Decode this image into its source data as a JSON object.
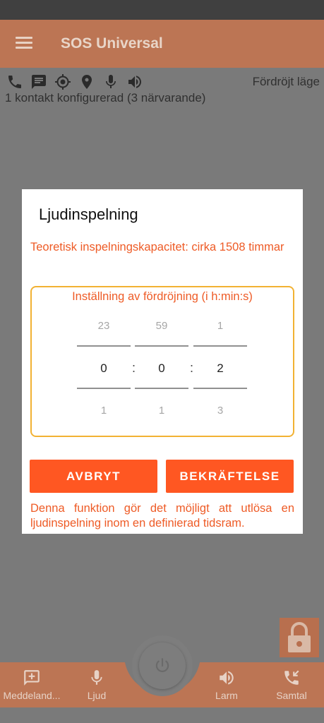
{
  "app": {
    "title": "SOS Universal"
  },
  "status": {
    "mode_label": "Fördröjt läge",
    "contacts_text": "1 kontakt konfigurerad (3 närvarande)",
    "icons": [
      "phone-icon",
      "message-icon",
      "gps-icon",
      "location-pin-icon",
      "microphone-icon",
      "speaker-icon"
    ]
  },
  "dialog": {
    "title": "Ljudinspelning",
    "capacity_text": "Teoretisk inspelningskapacitet: cirka 1508 timmar",
    "delay_label": "Inställning av fördröjning (i h:min:s)",
    "pickers": {
      "hours": {
        "prev": "23",
        "current": "0",
        "next": "1"
      },
      "minutes": {
        "prev": "59",
        "current": "0",
        "next": "1"
      },
      "seconds": {
        "prev": "1",
        "current": "2",
        "next": "3"
      }
    },
    "separator": ":",
    "cancel_label": "AVBRYT",
    "confirm_label": "BEKRÄFTELSE",
    "description": "Denna funktion gör det möjligt att utlösa en ljudinspelning inom en definierad tidsram."
  },
  "bottom_nav": {
    "items": [
      {
        "label": "Meddeland...",
        "icon": "add-message-icon"
      },
      {
        "label": "Ljud",
        "icon": "microphone-icon"
      },
      {
        "label": "Larm",
        "icon": "speaker-icon"
      },
      {
        "label": "Samtal",
        "icon": "incoming-call-icon"
      }
    ],
    "center_icon": "power-icon"
  },
  "colors": {
    "appbar": "#bc7554",
    "accent": "#ff5722",
    "accent_text": "#ee5b26",
    "picker_border": "#f2b233"
  }
}
